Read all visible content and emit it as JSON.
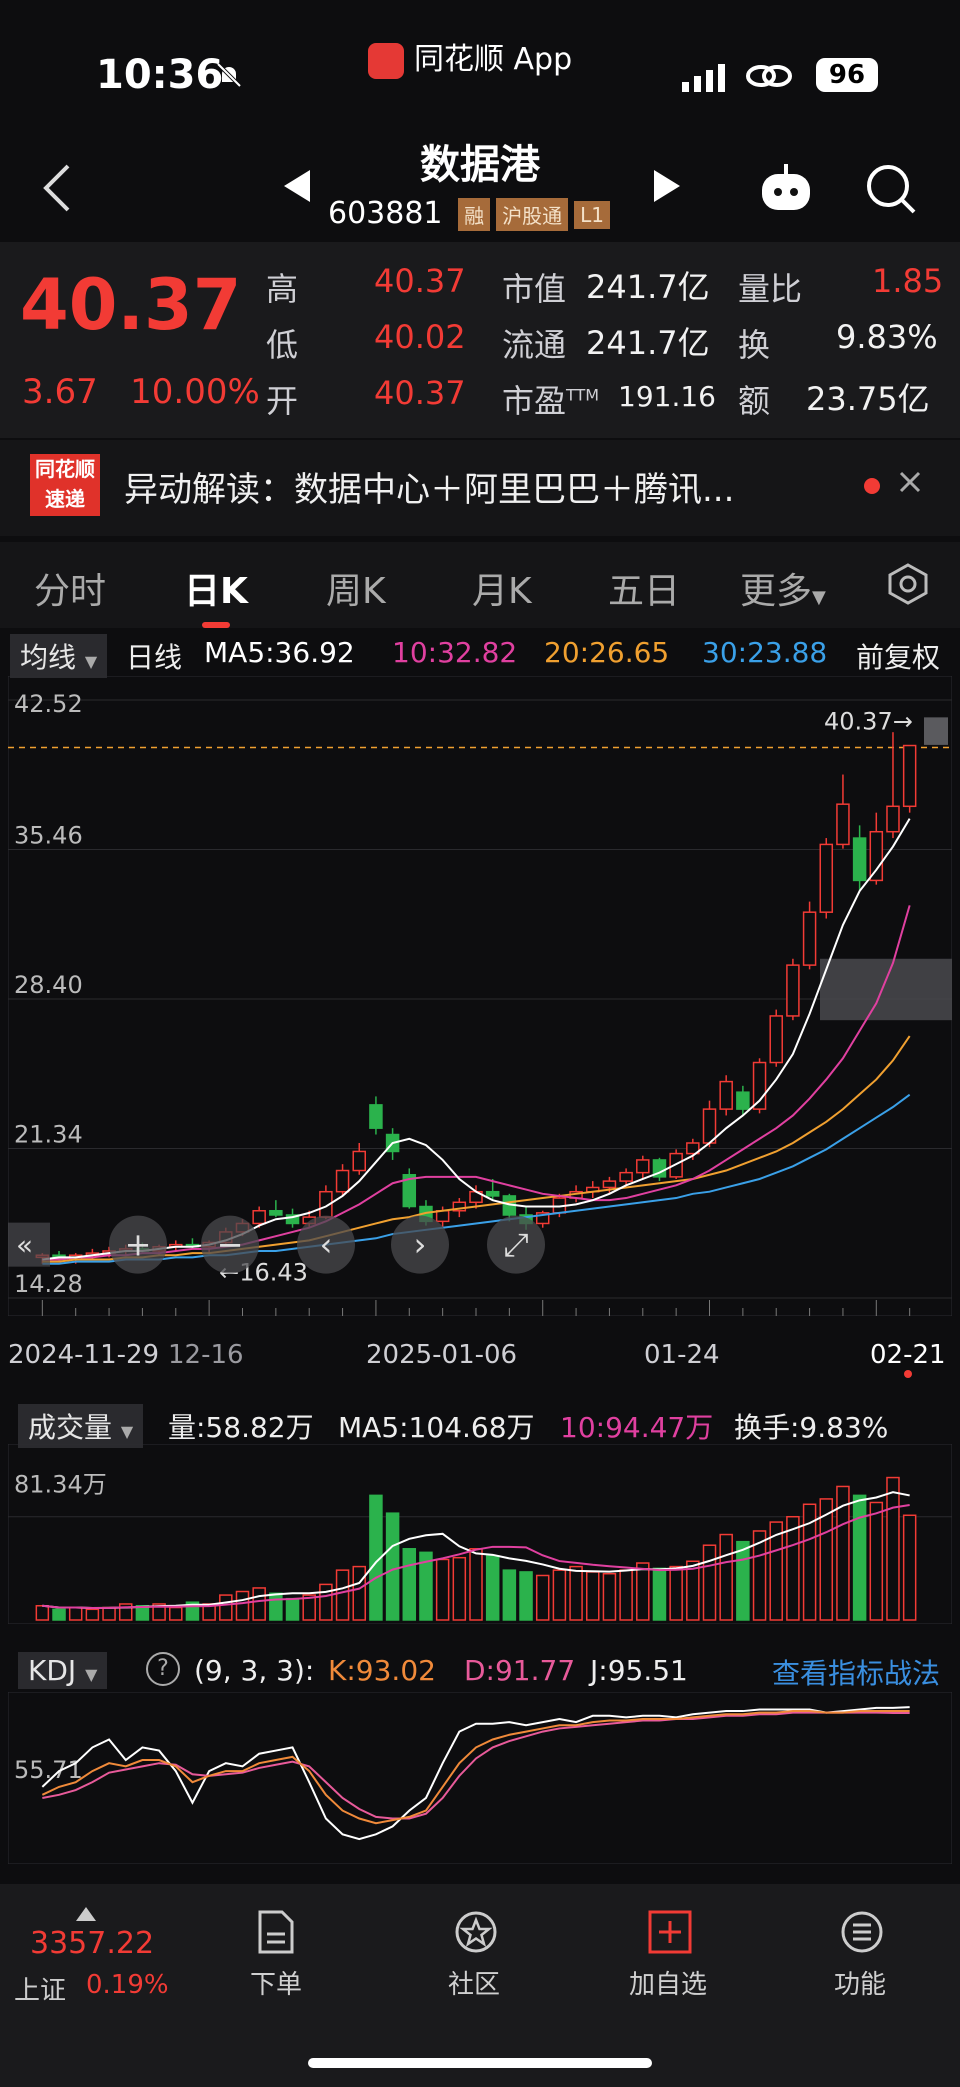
{
  "status": {
    "time": "10:36",
    "app": "同花顺 App",
    "battery": "96"
  },
  "header": {
    "title": "数据港",
    "code": "603881",
    "tags": [
      "融",
      "沪股通",
      "L1"
    ]
  },
  "quote": {
    "price": "40.37",
    "change": "3.67",
    "change_pct": "10.00%",
    "fields": [
      {
        "label": "高",
        "value": "40.37"
      },
      {
        "label": "低",
        "value": "40.02"
      },
      {
        "label": "开",
        "value": "40.37"
      },
      {
        "label": "市值",
        "value": "241.7亿"
      },
      {
        "label": "流通",
        "value": "241.7亿"
      },
      {
        "label": "市盈",
        "sup": "TTM",
        "value": "191.16"
      },
      {
        "label": "量比",
        "value": "1.85"
      },
      {
        "label": "换",
        "value": "9.83%"
      },
      {
        "label": "额",
        "value": "23.75亿"
      }
    ]
  },
  "ticker": {
    "logo_top": "同花顺",
    "logo_bottom": "速递",
    "text": "异动解读：数据中心＋阿里巴巴＋腾讯..."
  },
  "tabs": [
    "分时",
    "日K",
    "周K",
    "月K",
    "五日",
    "更多"
  ],
  "ma": {
    "select": "均线",
    "label": "日线",
    "ma5": "MA5:36.92",
    "ma10": "10:32.82",
    "ma20": "20:26.65",
    "ma30": "30:23.88",
    "adjust": "前复权",
    "colors": {
      "ma5": "#ffffff",
      "ma10": "#e040a0",
      "ma20": "#f0a030",
      "ma30": "#3aa0e8"
    }
  },
  "chart_data": [
    {
      "type": "candlestick",
      "title": "",
      "y_ticks": [
        "42.52",
        "35.46",
        "28.40",
        "21.34",
        "14.28"
      ],
      "ylim": [
        14.28,
        42.52
      ],
      "x_labels": [
        "2024-11-29",
        "12-16",
        "2025-01-06",
        "01-24",
        "02-21"
      ],
      "last_price_label": "40.37→",
      "low_label": "←16.43",
      "candles": [
        [
          16.2,
          16.4,
          15.9,
          16.3
        ],
        [
          16.3,
          16.5,
          16.0,
          16.1
        ],
        [
          16.1,
          16.4,
          15.9,
          16.3
        ],
        [
          16.3,
          16.6,
          16.1,
          16.4
        ],
        [
          16.4,
          16.7,
          16.2,
          16.5
        ],
        [
          16.5,
          16.8,
          16.3,
          16.6
        ],
        [
          16.6,
          16.9,
          16.4,
          16.5
        ],
        [
          16.5,
          16.8,
          16.3,
          16.7
        ],
        [
          16.7,
          17.0,
          16.5,
          16.8
        ],
        [
          16.8,
          17.1,
          16.6,
          16.7
        ],
        [
          16.7,
          17.0,
          16.43,
          16.9
        ],
        [
          16.9,
          17.6,
          16.8,
          17.4
        ],
        [
          17.4,
          18.0,
          17.2,
          17.8
        ],
        [
          17.8,
          18.6,
          17.6,
          18.4
        ],
        [
          18.4,
          18.9,
          18.1,
          18.2
        ],
        [
          18.2,
          18.5,
          17.6,
          17.8
        ],
        [
          17.8,
          18.4,
          17.6,
          18.1
        ],
        [
          18.1,
          19.6,
          18.0,
          19.3
        ],
        [
          19.3,
          20.6,
          19.1,
          20.3
        ],
        [
          20.3,
          21.6,
          20.1,
          21.2
        ],
        [
          23.4,
          23.8,
          22.0,
          22.3
        ],
        [
          22.0,
          22.3,
          20.8,
          21.2
        ],
        [
          20.1,
          20.4,
          18.5,
          18.6
        ],
        [
          18.6,
          18.9,
          17.7,
          17.9
        ],
        [
          17.9,
          18.6,
          17.6,
          18.4
        ],
        [
          18.4,
          19.0,
          18.1,
          18.8
        ],
        [
          18.8,
          19.6,
          18.5,
          19.3
        ],
        [
          19.3,
          19.9,
          18.9,
          19.1
        ],
        [
          19.1,
          19.2,
          17.9,
          18.2
        ],
        [
          18.2,
          18.6,
          17.5,
          17.8
        ],
        [
          17.8,
          18.4,
          17.6,
          18.3
        ],
        [
          18.3,
          19.2,
          18.1,
          19.0
        ],
        [
          19.0,
          19.6,
          18.8,
          19.3
        ],
        [
          19.3,
          19.8,
          19.0,
          19.5
        ],
        [
          19.5,
          20.0,
          19.2,
          19.8
        ],
        [
          19.8,
          20.4,
          19.6,
          20.2
        ],
        [
          20.2,
          21.0,
          19.9,
          20.8
        ],
        [
          20.8,
          20.9,
          19.8,
          20.0
        ],
        [
          20.0,
          21.3,
          19.9,
          21.1
        ],
        [
          21.1,
          21.8,
          20.8,
          21.6
        ],
        [
          21.6,
          23.6,
          21.4,
          23.2
        ],
        [
          23.2,
          24.8,
          22.9,
          24.5
        ],
        [
          24.0,
          24.3,
          22.9,
          23.2
        ],
        [
          23.2,
          25.6,
          23.0,
          25.4
        ],
        [
          25.4,
          27.9,
          25.2,
          27.6
        ],
        [
          27.6,
          30.3,
          27.4,
          30.0
        ],
        [
          30.0,
          33.0,
          29.8,
          32.5
        ],
        [
          32.5,
          36.0,
          32.2,
          35.7
        ],
        [
          35.7,
          39.0,
          35.5,
          37.6
        ],
        [
          36.0,
          36.6,
          33.5,
          34.0
        ],
        [
          34.0,
          37.2,
          33.8,
          36.3
        ],
        [
          36.3,
          41.0,
          36.0,
          37.5
        ],
        [
          37.5,
          40.37,
          37.2,
          40.37
        ]
      ],
      "ma5": [
        16.1,
        16.2,
        16.2,
        16.3,
        16.4,
        16.5,
        16.5,
        16.6,
        16.7,
        16.7,
        16.8,
        17.0,
        17.3,
        17.7,
        18.0,
        18.1,
        18.3,
        18.6,
        19.1,
        19.8,
        20.7,
        21.6,
        21.8,
        21.5,
        20.8,
        19.9,
        19.3,
        18.9,
        18.7,
        18.6,
        18.6,
        18.6,
        18.7,
        18.9,
        19.2,
        19.6,
        19.9,
        20.2,
        20.6,
        21.0,
        21.6,
        22.3,
        22.9,
        23.6,
        24.6,
        25.8,
        27.7,
        29.8,
        31.9,
        33.5,
        34.5,
        35.6,
        36.92
      ],
      "ma10": [
        16.1,
        16.1,
        16.2,
        16.2,
        16.3,
        16.3,
        16.4,
        16.4,
        16.5,
        16.6,
        16.6,
        16.7,
        16.8,
        17.0,
        17.2,
        17.4,
        17.6,
        17.9,
        18.3,
        18.7,
        19.2,
        19.7,
        19.9,
        20.0,
        20.0,
        20.0,
        20.0,
        19.8,
        19.6,
        19.4,
        19.2,
        19.1,
        19.0,
        18.9,
        18.9,
        19.0,
        19.2,
        19.4,
        19.6,
        19.9,
        20.3,
        20.8,
        21.3,
        21.8,
        22.3,
        22.9,
        23.7,
        24.6,
        25.6,
        26.9,
        28.2,
        30.1,
        32.82
      ],
      "ma20": [
        16.0,
        16.0,
        16.1,
        16.1,
        16.1,
        16.2,
        16.2,
        16.3,
        16.3,
        16.4,
        16.4,
        16.5,
        16.6,
        16.7,
        16.8,
        16.9,
        17.0,
        17.2,
        17.4,
        17.6,
        17.8,
        18.0,
        18.1,
        18.3,
        18.4,
        18.5,
        18.6,
        18.7,
        18.8,
        18.9,
        19.0,
        19.1,
        19.2,
        19.3,
        19.4,
        19.5,
        19.6,
        19.7,
        19.8,
        19.9,
        20.1,
        20.3,
        20.6,
        20.9,
        21.2,
        21.6,
        22.1,
        22.6,
        23.2,
        23.9,
        24.6,
        25.5,
        26.65
      ],
      "ma30": [
        15.9,
        15.9,
        16.0,
        16.0,
        16.0,
        16.1,
        16.1,
        16.1,
        16.2,
        16.2,
        16.3,
        16.3,
        16.4,
        16.5,
        16.5,
        16.6,
        16.7,
        16.8,
        16.9,
        17.0,
        17.1,
        17.3,
        17.4,
        17.5,
        17.6,
        17.7,
        17.8,
        17.9,
        18.0,
        18.1,
        18.2,
        18.3,
        18.4,
        18.5,
        18.6,
        18.7,
        18.8,
        18.9,
        19.0,
        19.2,
        19.3,
        19.5,
        19.7,
        19.9,
        20.2,
        20.5,
        20.9,
        21.3,
        21.8,
        22.3,
        22.8,
        23.3,
        23.88
      ]
    },
    {
      "type": "bar",
      "title": "",
      "label": "成交量",
      "y_tick": "81.34万",
      "values": [
        8,
        6,
        7,
        6,
        7,
        9,
        8,
        9,
        7,
        10,
        9,
        14,
        16,
        18,
        15,
        12,
        14,
        20,
        28,
        30,
        70,
        60,
        40,
        38,
        34,
        35,
        40,
        36,
        28,
        27,
        25,
        28,
        30,
        27,
        26,
        28,
        32,
        29,
        30,
        33,
        42,
        48,
        44,
        50,
        55,
        58,
        65,
        68,
        75,
        70,
        66,
        80,
        58.82
      ]
    },
    {
      "type": "line",
      "title": "",
      "label": "KDJ",
      "y_tick": "55.71",
      "series": [
        {
          "name": "K",
          "values": [
            40,
            45,
            48,
            55,
            60,
            58,
            62,
            62,
            58,
            48,
            52,
            55,
            55,
            60,
            62,
            64,
            55,
            40,
            30,
            25,
            22,
            24,
            26,
            30,
            45,
            60,
            70,
            75,
            78,
            80,
            82,
            84,
            84,
            86,
            87,
            87,
            88,
            88,
            88,
            89,
            90,
            91,
            91,
            92,
            92,
            93,
            93,
            92,
            92,
            93,
            93,
            93,
            93.02
          ]
        },
        {
          "name": "D",
          "values": [
            38,
            40,
            43,
            48,
            54,
            56,
            58,
            60,
            59,
            53,
            52,
            53,
            54,
            57,
            59,
            61,
            58,
            48,
            38,
            31,
            26,
            25,
            25,
            28,
            38,
            52,
            63,
            70,
            74,
            77,
            80,
            82,
            83,
            84,
            85,
            86,
            87,
            87,
            88,
            88,
            89,
            90,
            90,
            91,
            91,
            92,
            92,
            92,
            92,
            92,
            92,
            91.8,
            91.77
          ]
        },
        {
          "name": "J",
          "values": [
            45,
            55,
            60,
            70,
            75,
            62,
            70,
            68,
            55,
            35,
            55,
            60,
            58,
            66,
            68,
            70,
            48,
            25,
            15,
            12,
            15,
            20,
            30,
            38,
            60,
            80,
            85,
            85,
            86,
            84,
            86,
            88,
            86,
            90,
            90,
            89,
            90,
            90,
            89,
            91,
            92,
            93,
            93,
            94,
            94,
            94,
            94,
            92,
            93,
            94,
            95,
            95,
            95.51
          ]
        }
      ]
    }
  ],
  "vol": {
    "select": "成交量",
    "vol": "量:58.82万",
    "ma5": "MA5:104.68万",
    "ma10": "10:94.47万",
    "turnover": "换手:9.83%"
  },
  "kdj": {
    "select": "KDJ",
    "help": "?",
    "params": "(9, 3, 3):",
    "k": "K:93.02",
    "d": "D:91.77",
    "j": "J:95.51",
    "link": "查看指标战法"
  },
  "bottom": {
    "index_value": "3357.22",
    "index_name": "上证",
    "index_pct": "0.19%",
    "items": [
      "下单",
      "社区",
      "加自选",
      "功能"
    ]
  }
}
